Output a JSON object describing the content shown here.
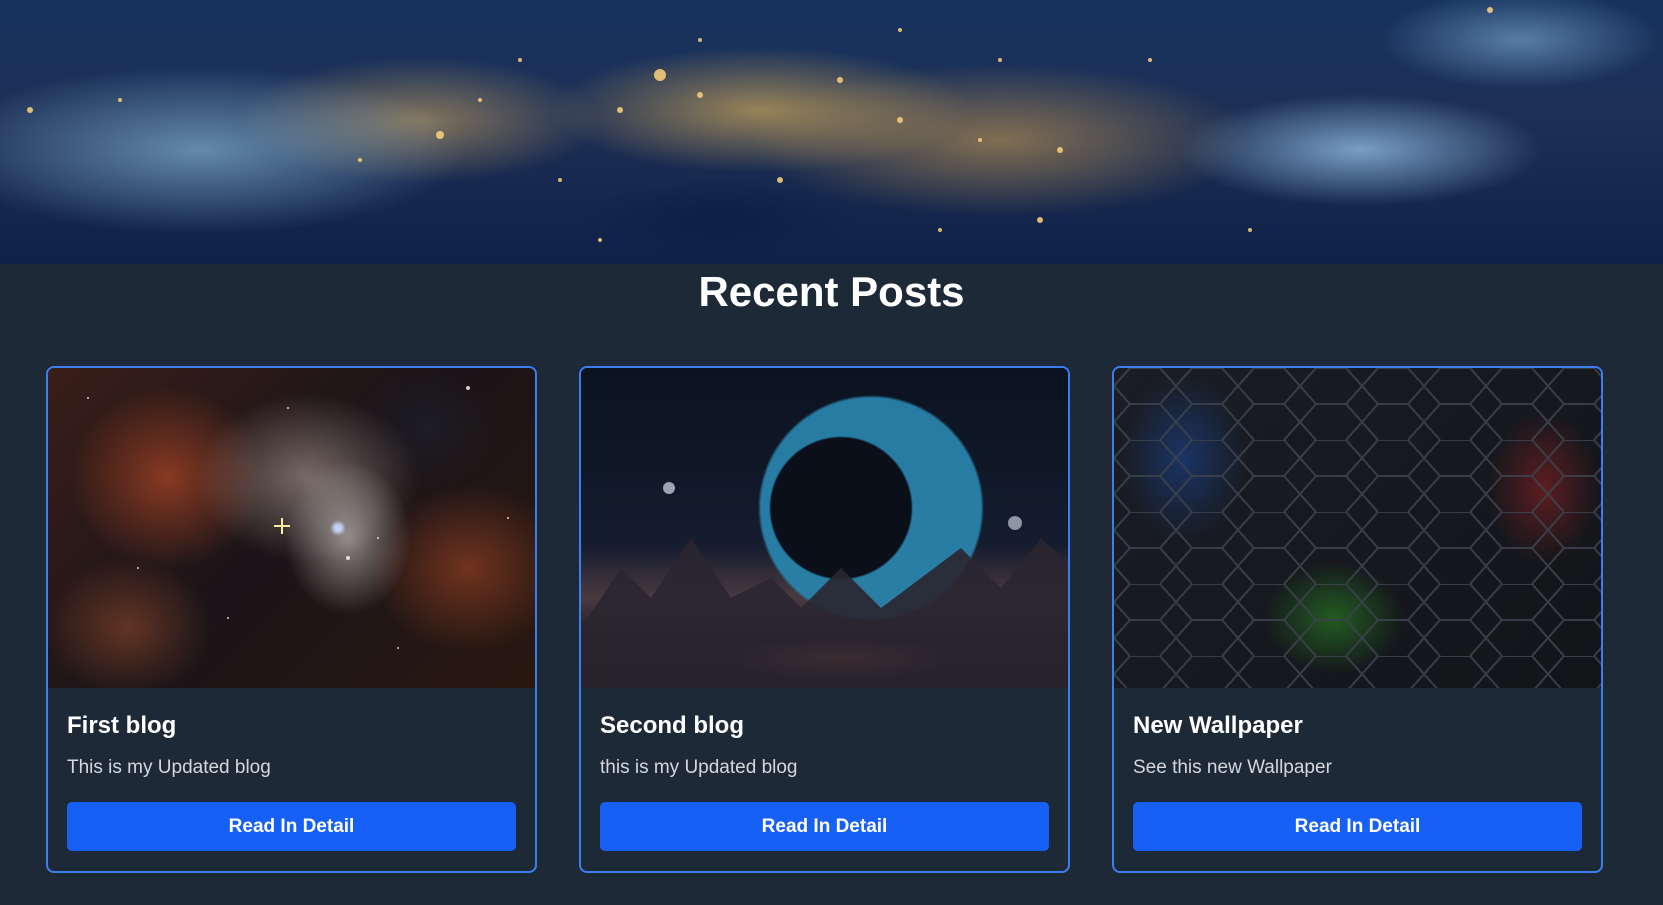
{
  "hero": {
    "image": "earth-at-night-from-space"
  },
  "page": {
    "title": "Recent Posts"
  },
  "posts": [
    {
      "image": "orange-nebula-star-field",
      "title": "First blog",
      "description": "This is my Updated blog",
      "button_label": "Read In Detail"
    },
    {
      "image": "fantasy-planet-over-mountains",
      "title": "Second blog",
      "description": "this is my Updated blog",
      "button_label": "Read In Detail"
    },
    {
      "image": "dark-hexagon-wallpaper",
      "title": "New Wallpaper",
      "description": "See this new Wallpaper",
      "button_label": "Read In Detail"
    }
  ],
  "colors": {
    "background": "#1e2937",
    "card_border": "#3c7ef0",
    "button": "#1760f6",
    "title": "#ffffff",
    "description": "#d4d8de"
  }
}
